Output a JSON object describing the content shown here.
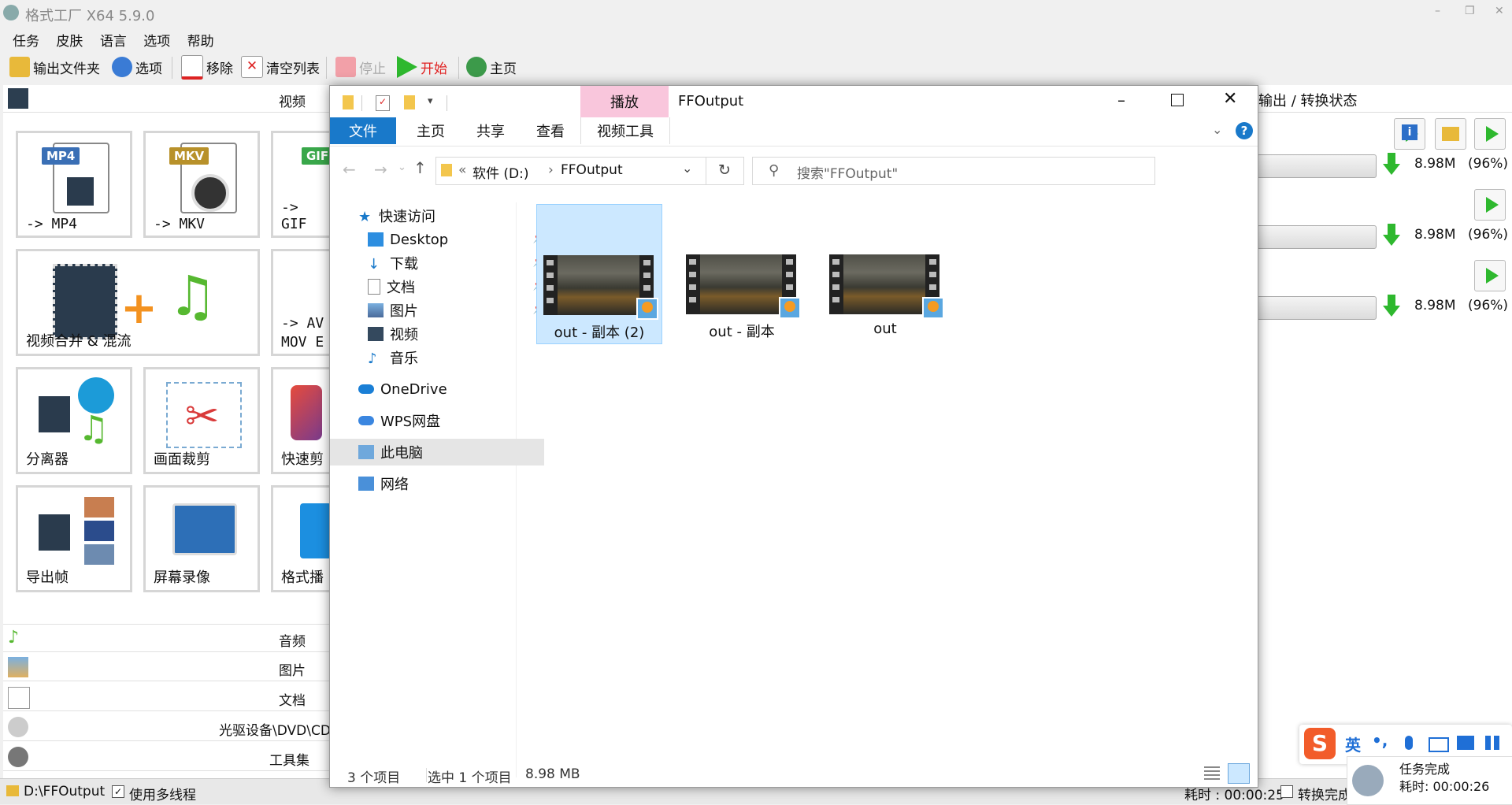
{
  "app": {
    "title": "格式工厂 X64 5.9.0",
    "menu": [
      "任务",
      "皮肤",
      "语言",
      "选项",
      "帮助"
    ],
    "toolbar": {
      "output_folder": "输出文件夹",
      "options": "选项",
      "remove": "移除",
      "clear_list": "清空列表",
      "stop": "停止",
      "start": "开始",
      "home": "主页"
    },
    "categories": {
      "video": "视频",
      "audio": "音频",
      "picture": "图片",
      "document": "文档",
      "rom": "光驱设备\\DVD\\CD",
      "tools": "工具集"
    },
    "tiles": {
      "mp4": "-> MP4",
      "mkv": "-> MKV",
      "gif": "-> GIF",
      "merge": "视频合并 & 混流",
      "av": "-> AV",
      "mov": "MOV E",
      "splitter": "分离器",
      "crop": "画面裁剪",
      "quick": "快速剪",
      "export": "导出帧",
      "record": "屏幕录像",
      "player": "格式播",
      "badge_mp4": "MP4",
      "badge_mkv": "MKV",
      "badge_gif": "GIF"
    },
    "right_header": "输出 / 转换状态",
    "tasks": [
      {
        "size": "8.98M",
        "pct": "(96%)"
      },
      {
        "size": "8.98M",
        "pct": "(96%)"
      },
      {
        "size": "8.98M",
        "pct": "(96%)"
      }
    ],
    "status": {
      "path": "D:\\FFOutput",
      "multithread": "使用多线程",
      "elapsed": "耗时 : 00:00:25",
      "done_check": "转换完成"
    },
    "toast": {
      "title": "任务完成",
      "elapsed": "耗时: 00:00:26"
    }
  },
  "explorer": {
    "context_tab": "播放",
    "title": "FFOutput",
    "ribbon": {
      "file": "文件",
      "home": "主页",
      "share": "共享",
      "view": "查看",
      "video_tools": "视频工具"
    },
    "address": {
      "prefix": "«",
      "drive": "软件 (D:)",
      "sep": "›",
      "folder": "FFOutput"
    },
    "search_placeholder": "搜索\"FFOutput\"",
    "nav": {
      "quick_access": "快速访问",
      "desktop": "Desktop",
      "downloads": "下载",
      "docs": "文档",
      "pictures": "图片",
      "videos": "视频",
      "music": "音乐",
      "onedrive": "OneDrive",
      "wps": "WPS网盘",
      "this_pc": "此电脑",
      "network": "网络"
    },
    "files": [
      "out - 副本 (2)",
      "out - 副本",
      "out"
    ],
    "status": {
      "count": "3 个项目",
      "selected": "选中 1 个项目",
      "size": "8.98 MB"
    }
  },
  "ime": {
    "lang": "英",
    "punct": "•,"
  },
  "colors": {
    "explorer_accent": "#1979ca",
    "context_tab_bg": "#f9c6dc",
    "selection_bg": "#cce8ff",
    "play_green": "#2eb82e",
    "start_red": "#e02020"
  }
}
